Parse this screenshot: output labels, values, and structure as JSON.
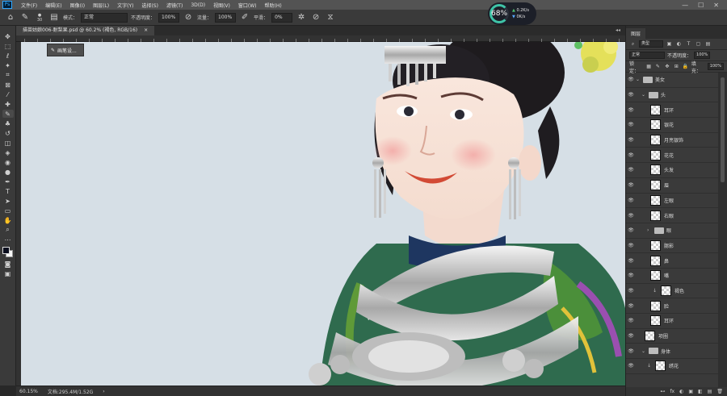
{
  "menubar": {
    "logo": "Ps",
    "items": [
      "文件(F)",
      "编辑(E)",
      "图像(I)",
      "图层(L)",
      "文字(Y)",
      "选择(S)",
      "滤镜(T)",
      "3D(D)",
      "视图(V)",
      "窗口(W)",
      "帮助(H)"
    ],
    "window_controls": [
      "—",
      "☐",
      "✕"
    ]
  },
  "options": {
    "brush_size": "30",
    "mode_label": "模式：",
    "mode_value": "正常",
    "opacity_label": "不透明度：",
    "opacity_value": "100%",
    "flow_label": "流量：",
    "flow_value": "100%",
    "smooth_label": "平滑：",
    "smooth_value": "0%"
  },
  "perf": {
    "percent": "68%",
    "up": "0.2K/s",
    "down": "0K/s"
  },
  "document": {
    "tab_label": "描苗姑娘006-耐梨果.psd @ 60.2% (褐色, RGB/16)",
    "tab_close": "×",
    "tab_right": "◂◂"
  },
  "brush_popup": {
    "label": "画笔设..."
  },
  "status": {
    "zoom": "60.15%",
    "doc_info": "文档:295.4M/1.52G",
    "arrow": "›"
  },
  "panel": {
    "tab_label": "图层",
    "filter_label": "类型",
    "mode_value": "正常",
    "opacity_label": "不透明度：",
    "opacity_value": "100%",
    "lock_label": "锁定：",
    "fill_label": "填充：",
    "fill_value": "100%",
    "layers": [
      {
        "name": "美女",
        "type": "group",
        "indent": 0,
        "visible": true,
        "expanded": true
      },
      {
        "name": "头",
        "type": "group",
        "indent": 1,
        "visible": true,
        "expanded": true
      },
      {
        "name": "耳环",
        "type": "layer",
        "indent": 2,
        "visible": true
      },
      {
        "name": "银花",
        "type": "layer",
        "indent": 2,
        "visible": true
      },
      {
        "name": "月亮银饰",
        "type": "layer",
        "indent": 2,
        "visible": true
      },
      {
        "name": "花花",
        "type": "layer",
        "indent": 2,
        "visible": true
      },
      {
        "name": "头发",
        "type": "layer",
        "indent": 2,
        "visible": true
      },
      {
        "name": "眉",
        "type": "layer",
        "indent": 2,
        "visible": true
      },
      {
        "name": "左眼",
        "type": "layer",
        "indent": 2,
        "visible": true
      },
      {
        "name": "右眼",
        "type": "layer",
        "indent": 2,
        "visible": true
      },
      {
        "name": "眼",
        "type": "group",
        "indent": 2,
        "visible": true,
        "expanded": false
      },
      {
        "name": "腮影",
        "type": "layer",
        "indent": 2,
        "visible": true
      },
      {
        "name": "鼻",
        "type": "layer",
        "indent": 2,
        "visible": true
      },
      {
        "name": "嘴",
        "type": "layer",
        "indent": 2,
        "visible": true
      },
      {
        "name": "褐色",
        "type": "layer",
        "indent": 3,
        "visible": true,
        "clip": true
      },
      {
        "name": "脸",
        "type": "layer",
        "indent": 2,
        "visible": true
      },
      {
        "name": "耳环",
        "type": "layer",
        "indent": 2,
        "visible": true
      },
      {
        "name": "项圈",
        "type": "layer",
        "indent": 1,
        "visible": true
      },
      {
        "name": "身体",
        "type": "group",
        "indent": 1,
        "visible": true,
        "expanded": true
      },
      {
        "name": "绣花",
        "type": "layer",
        "indent": 2,
        "visible": true,
        "clip": true
      }
    ],
    "footer_icons": [
      "fx",
      "◐",
      "▣",
      "◧",
      "▤",
      "🗑"
    ]
  }
}
